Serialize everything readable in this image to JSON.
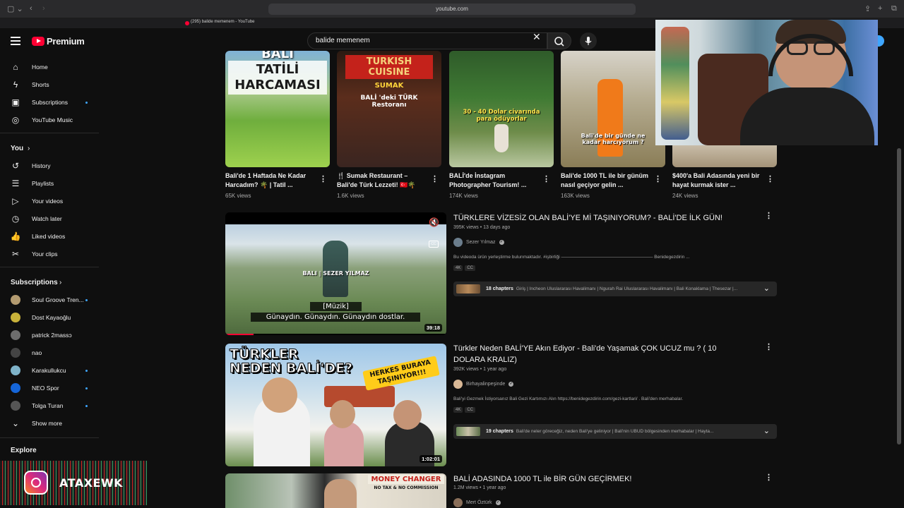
{
  "browser": {
    "url": "youtube.com",
    "tab_title": "(295) balide memenem - YouTube"
  },
  "header": {
    "logo_text": "Premium",
    "search_value": "balide memenem"
  },
  "sidebar": {
    "main": [
      {
        "label": "Home",
        "icon": "home-icon"
      },
      {
        "label": "Shorts",
        "icon": "shorts-icon"
      },
      {
        "label": "Subscriptions",
        "icon": "subscriptions-icon"
      },
      {
        "label": "YouTube Music",
        "icon": "music-icon"
      }
    ],
    "you_heading": "You",
    "you": [
      {
        "label": "History",
        "icon": "history-icon"
      },
      {
        "label": "Playlists",
        "icon": "playlists-icon"
      },
      {
        "label": "Your videos",
        "icon": "your-videos-icon"
      },
      {
        "label": "Watch later",
        "icon": "watch-later-icon"
      },
      {
        "label": "Liked videos",
        "icon": "like-icon"
      },
      {
        "label": "Your clips",
        "icon": "clips-icon"
      }
    ],
    "subs_heading": "Subscriptions",
    "subs": [
      {
        "label": "Soul Groove Tren...",
        "color": "#b39b70"
      },
      {
        "label": "Dost Kayaoğlu",
        "color": "#c9b23a"
      },
      {
        "label": "patrick 2massɔ",
        "color": "#6d6d6d"
      },
      {
        "label": "nao",
        "color": "#444"
      },
      {
        "label": "Karakullukcu",
        "color": "#7fb3c9"
      },
      {
        "label": "NEO Spor",
        "color": "#1565d8"
      },
      {
        "label": "Tolga Turan",
        "color": "#555"
      }
    ],
    "show_more": "Show more",
    "explore_heading": "Explore"
  },
  "shorts": [
    {
      "title": "Bali'de 1 Haftada Ne Kadar Harcadım? 🌴 | Tatil ...",
      "views": "65K views",
      "overlay": "TATİLİ HARCAMASI",
      "overlay_top": "BALİ"
    },
    {
      "title": "🍴 Sumak Restaurant – Bali'de Türk Lezzeti! 🇹🇷🌴",
      "views": "1.6K views",
      "overlay": "SUMAK",
      "overlay_top": "TURKISH CUISINE",
      "overlay_sub": "BALİ 'deki TÜRK Restoranı"
    },
    {
      "title": "BALİ'de İnstagram Photographer Tourism! ...",
      "views": "174K views",
      "overlay": "30 - 40 Dolar civarında para ödüyorlar"
    },
    {
      "title": "Bali'de 1000 TL ile bir günüm nasıl geçiyor gelin ...",
      "views": "163K views",
      "overlay": "Bali'de bir günde ne kadar harcıyorum ?"
    },
    {
      "title": "$400'a Bali Adasında yeni bir hayat kurmak ister ...",
      "views": "24K views"
    }
  ],
  "videos": [
    {
      "title": "TÜRKLERE VİZESİZ OLAN BALİ'YE Mİ TAŞINIYORUM? - BALİ'DE İLK GÜN!",
      "meta": "395K views • 13 days ago",
      "channel": "Sezer Yılmaz",
      "desc": "Bu videoda ürün yerleştirme bulunmaktadır. #işbirliği ———————————————————— Benidegezdirin ...",
      "badges": [
        "4K",
        "CC"
      ],
      "chapters_count": "18 chapters",
      "chapters_list": "Giriş | Incheon Uluslararası Havalimanı | Ngurah Rai Uluslararası Havalimanı | Bali Konaklama | Thesezar |...",
      "duration": "39:18",
      "caption1": "[Müzik]",
      "caption2": "Günaydın. Günaydın. Günaydın dostlar.",
      "thumb_label": "BALI | SEZER YILMAZ",
      "cc_label": "CC"
    },
    {
      "title": "Türkler Neden BALİ'YE Akın Ediyor - Bali'de Yaşamak ÇOK UCUZ mu ? ( 10 DOLARA KRALIZ)",
      "meta": "392K views • 1 year ago",
      "channel": "Birhayalinpeşinde",
      "desc": "Bali'yi Gezmek İstiyorsanız Bali Gezi Kartımızı Alın https://benidegezdirin.com/gezi-kartlari/ . Bali'den merhabalar.",
      "badges": [
        "4K",
        "CC"
      ],
      "chapters_count": "19 chapters",
      "chapters_list": "Bali'de neler göreceğiz, neden Bali'ye geliniyor | Bali'nin UBUD bölgesinden merhabalar | Hayta...",
      "duration": "1:02:01",
      "thumb_text1": "TÜRKLER",
      "thumb_text2": "NEDEN BALİ'DE?",
      "thumb_text3": "HERKES BURAYA TAŞINIYOR!!!"
    },
    {
      "title": "BALİ ADASINDA 1000 TL ile BİR GÜN GEÇİRMEK!",
      "meta": "1.2M views • 1 year ago",
      "channel": "Mert Öztürk",
      "thumb_text": "MONEY CHANGER",
      "thumb_sub": "NO TAX & NO COMMISSION"
    }
  ],
  "instagram": {
    "handle": "ATAXEWK"
  },
  "colors": {
    "accent": "#ff0033",
    "link": "#3ea6ff",
    "bg": "#0f0f0f"
  }
}
